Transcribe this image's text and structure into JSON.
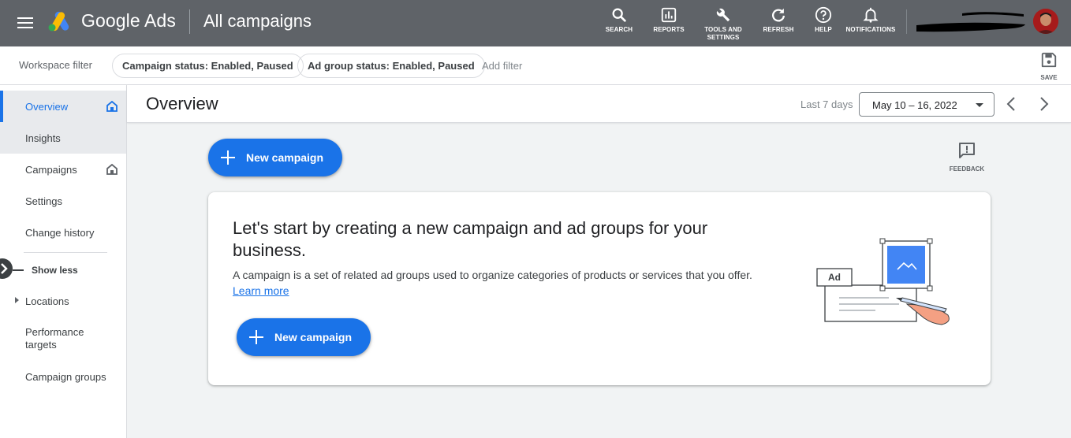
{
  "app": {
    "product_name": "Google Ads",
    "page_heading": "All campaigns"
  },
  "toolbar": {
    "actions": [
      {
        "label": "SEARCH",
        "icon": "search-icon"
      },
      {
        "label": "REPORTS",
        "icon": "reports-icon"
      },
      {
        "label": "TOOLS AND\nSETTINGS",
        "icon": "wrench-icon"
      },
      {
        "label": "REFRESH",
        "icon": "refresh-icon"
      },
      {
        "label": "HELP",
        "icon": "help-icon"
      },
      {
        "label": "NOTIFICATIONS",
        "icon": "bell-icon"
      }
    ]
  },
  "filters": {
    "workspace_label": "Workspace filter",
    "chips": [
      "Campaign status: Enabled, Paused",
      "Ad group status: Enabled, Paused"
    ],
    "add_filter": "Add filter",
    "save_label": "SAVE"
  },
  "sidebar": {
    "items": [
      {
        "label": "Overview",
        "state": "active",
        "home_icon": true
      },
      {
        "label": "Insights",
        "state": "shaded"
      },
      {
        "label": "Campaigns",
        "home_icon": true
      },
      {
        "label": "Settings"
      },
      {
        "label": "Change history"
      }
    ],
    "show_less": "Show less",
    "more_items": [
      {
        "label": "Locations",
        "expandable": true
      },
      {
        "label": "Performance targets"
      },
      {
        "label": "Campaign groups"
      }
    ]
  },
  "header": {
    "title": "Overview",
    "date_range_caption": "Last 7 days",
    "date_range_value": "May 10 – 16, 2022"
  },
  "actions": {
    "new_campaign": "New campaign",
    "feedback": "FEEDBACK"
  },
  "card": {
    "title": "Let's start by creating a new campaign and ad groups for your business.",
    "description": "A campaign is a set of related ad groups used to organize categories of products or services that you offer.",
    "learn_more": "Learn more",
    "button": "New campaign",
    "illustration_label": "Ad"
  },
  "colors": {
    "topbar": "#5f6368",
    "accent": "#1a73e8",
    "background": "#f1f3f4"
  }
}
